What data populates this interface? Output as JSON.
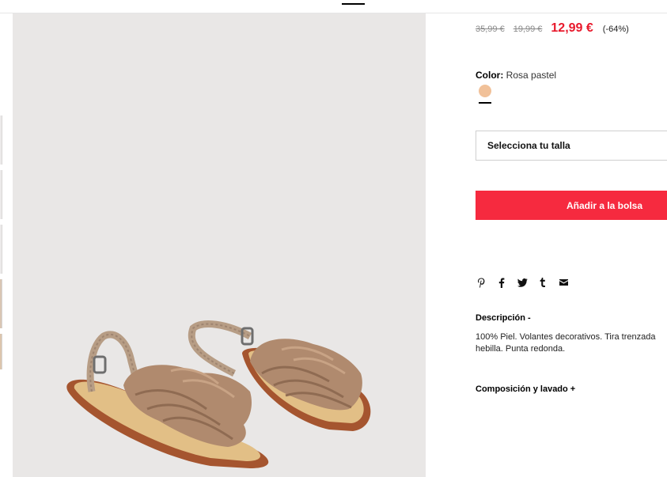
{
  "product": {
    "prices": {
      "original": "35,99 €",
      "previous": "19,99 €",
      "current": "12,99 €",
      "discount": "(-64%)"
    },
    "color": {
      "label": "Color:",
      "value": "Rosa pastel",
      "swatch_color": "#f1c199"
    },
    "size_select": {
      "placeholder": "Selecciona tu talla"
    },
    "add_to_bag_label": "Añadir a la bolsa",
    "share_icons": [
      "pinterest-icon",
      "facebook-icon",
      "twitter-icon",
      "tumblr-icon",
      "email-icon"
    ],
    "description": {
      "title": "Descripción -",
      "lines": [
        "100% Piel. Volantes decorativos. Tira trenzada",
        "hebilla. Punta redonda."
      ]
    },
    "composition_title": "Composición y lavado +"
  },
  "colors": {
    "sale_red": "#e8192c",
    "button_red": "#f62a3f",
    "image_bg": "#e9e7e6"
  }
}
